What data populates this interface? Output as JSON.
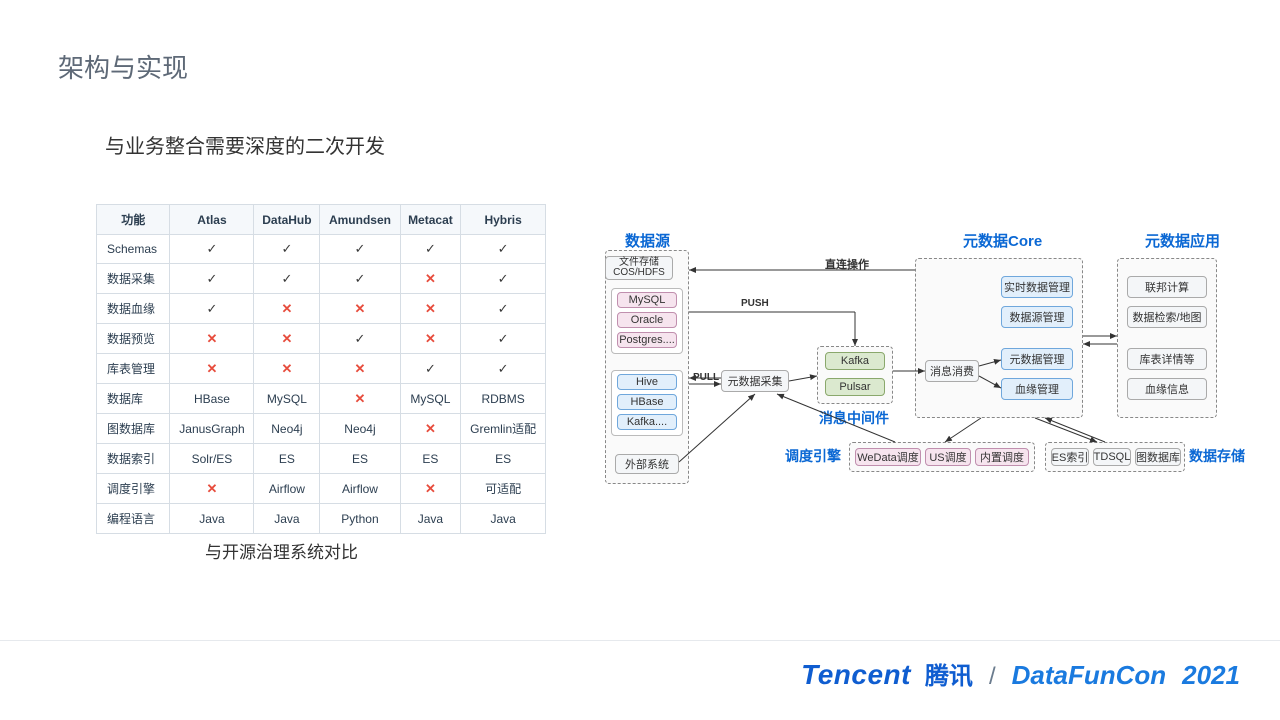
{
  "page": {
    "title": "架构与实现",
    "subtitle": "与业务整合需要深度的二次开发",
    "table_caption": "与开源治理系统对比"
  },
  "table": {
    "headers": [
      "功能",
      "Atlas",
      "DataHub",
      "Amundsen",
      "Metacat",
      "Hybris"
    ],
    "rows": [
      {
        "label": "Schemas",
        "cells": [
          "✓",
          "✓",
          "✓",
          "✓",
          "✓"
        ]
      },
      {
        "label": "数据采集",
        "cells": [
          "✓",
          "✓",
          "✓",
          "×",
          "✓"
        ]
      },
      {
        "label": "数据血缘",
        "cells": [
          "✓",
          "×",
          "×",
          "×",
          "✓"
        ]
      },
      {
        "label": "数据预览",
        "cells": [
          "×",
          "×",
          "✓",
          "×",
          "✓"
        ]
      },
      {
        "label": "库表管理",
        "cells": [
          "×",
          "×",
          "×",
          "✓",
          "✓"
        ]
      },
      {
        "label": "数据库",
        "cells": [
          "HBase",
          "MySQL",
          "×",
          "MySQL",
          "RDBMS"
        ]
      },
      {
        "label": "图数据库",
        "cells": [
          "JanusGraph",
          "Neo4j",
          "Neo4j",
          "×",
          "Gremlin适配"
        ]
      },
      {
        "label": "数据索引",
        "cells": [
          "Solr/ES",
          "ES",
          "ES",
          "ES",
          "ES"
        ]
      },
      {
        "label": "调度引擎",
        "cells": [
          "×",
          "Airflow",
          "Airflow",
          "×",
          "可适配"
        ]
      },
      {
        "label": "编程语言",
        "cells": [
          "Java",
          "Java",
          "Python",
          "Java",
          "Java"
        ]
      }
    ]
  },
  "diagram": {
    "sections": {
      "source": "数据源",
      "core": "元数据Core",
      "app": "元数据应用",
      "msg": "消息中间件",
      "sched": "调度引擎",
      "store": "数据存储"
    },
    "nodes": {
      "file_store": "文件存储",
      "file_store_sub": "COS/HDFS",
      "mysql": "MySQL",
      "oracle": "Oracle",
      "postgres": "Postgres....",
      "hive": "Hive",
      "hbase": "HBase",
      "kafka_src": "Kafka....",
      "ext": "外部系统",
      "collect": "元数据采集",
      "kafka": "Kafka",
      "pulsar": "Pulsar",
      "consume": "消息消费",
      "rt_mgmt": "实时数据管理",
      "src_mgmt": "数据源管理",
      "meta_mgmt": "元数据管理",
      "lineage": "血缘管理",
      "app_fed": "联邦计算",
      "app_search": "数据检索/地图",
      "app_detail": "库表详情等",
      "app_lineage": "血缘信息",
      "wedata": "WeData调度",
      "us": "US调度",
      "builtin": "内置调度",
      "es": "ES索引",
      "tdsql": "TDSQL",
      "graphdb": "图数据库"
    },
    "labels": {
      "direct": "直连操作",
      "push": "PUSH",
      "pull": "PULL"
    }
  },
  "footer": {
    "tencent_en": "Tencent",
    "tencent_zh": "腾讯",
    "slash": "/",
    "dfc": "DataFunCon",
    "year": "2021"
  },
  "chart_data": {
    "type": "table",
    "title": "与开源治理系统对比",
    "columns": [
      "Atlas",
      "DataHub",
      "Amundsen",
      "Metacat",
      "Hybris"
    ],
    "rows": {
      "Schemas": [
        "yes",
        "yes",
        "yes",
        "yes",
        "yes"
      ],
      "数据采集": [
        "yes",
        "yes",
        "yes",
        "no",
        "yes"
      ],
      "数据血缘": [
        "yes",
        "no",
        "no",
        "no",
        "yes"
      ],
      "数据预览": [
        "no",
        "no",
        "yes",
        "no",
        "yes"
      ],
      "库表管理": [
        "no",
        "no",
        "no",
        "yes",
        "yes"
      ],
      "数据库": [
        "HBase",
        "MySQL",
        "no",
        "MySQL",
        "RDBMS"
      ],
      "图数据库": [
        "JanusGraph",
        "Neo4j",
        "Neo4j",
        "no",
        "Gremlin适配"
      ],
      "数据索引": [
        "Solr/ES",
        "ES",
        "ES",
        "ES",
        "ES"
      ],
      "调度引擎": [
        "no",
        "Airflow",
        "Airflow",
        "no",
        "可适配"
      ],
      "编程语言": [
        "Java",
        "Java",
        "Python",
        "Java",
        "Java"
      ]
    }
  }
}
